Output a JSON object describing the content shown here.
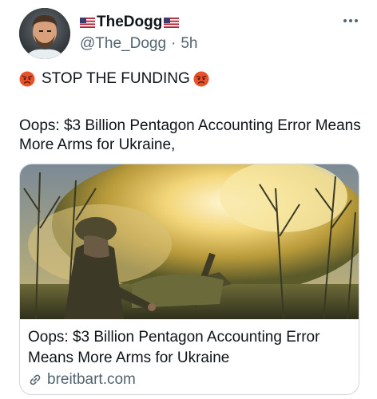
{
  "author": {
    "display_name": "TheDogg",
    "handle": "@The_Dogg",
    "separator": "·",
    "time": "5h",
    "flag_icons": [
      "us-flag-icon",
      "us-flag-icon"
    ]
  },
  "post": {
    "line1_text": "STOP THE FUNDING",
    "line1_emoji": "angry-face-icon",
    "body": "Oops: $3 Billion Pentagon Accounting Error Means More Arms for Ukraine,"
  },
  "card": {
    "title": "Oops: $3 Billion Pentagon Accounting Error Means More Arms for Ukraine",
    "domain": "breitbart.com",
    "image_icon": "artillery-photo"
  },
  "colors": {
    "text": "#0f1419",
    "secondary": "#536471",
    "border": "#cfd9de"
  }
}
